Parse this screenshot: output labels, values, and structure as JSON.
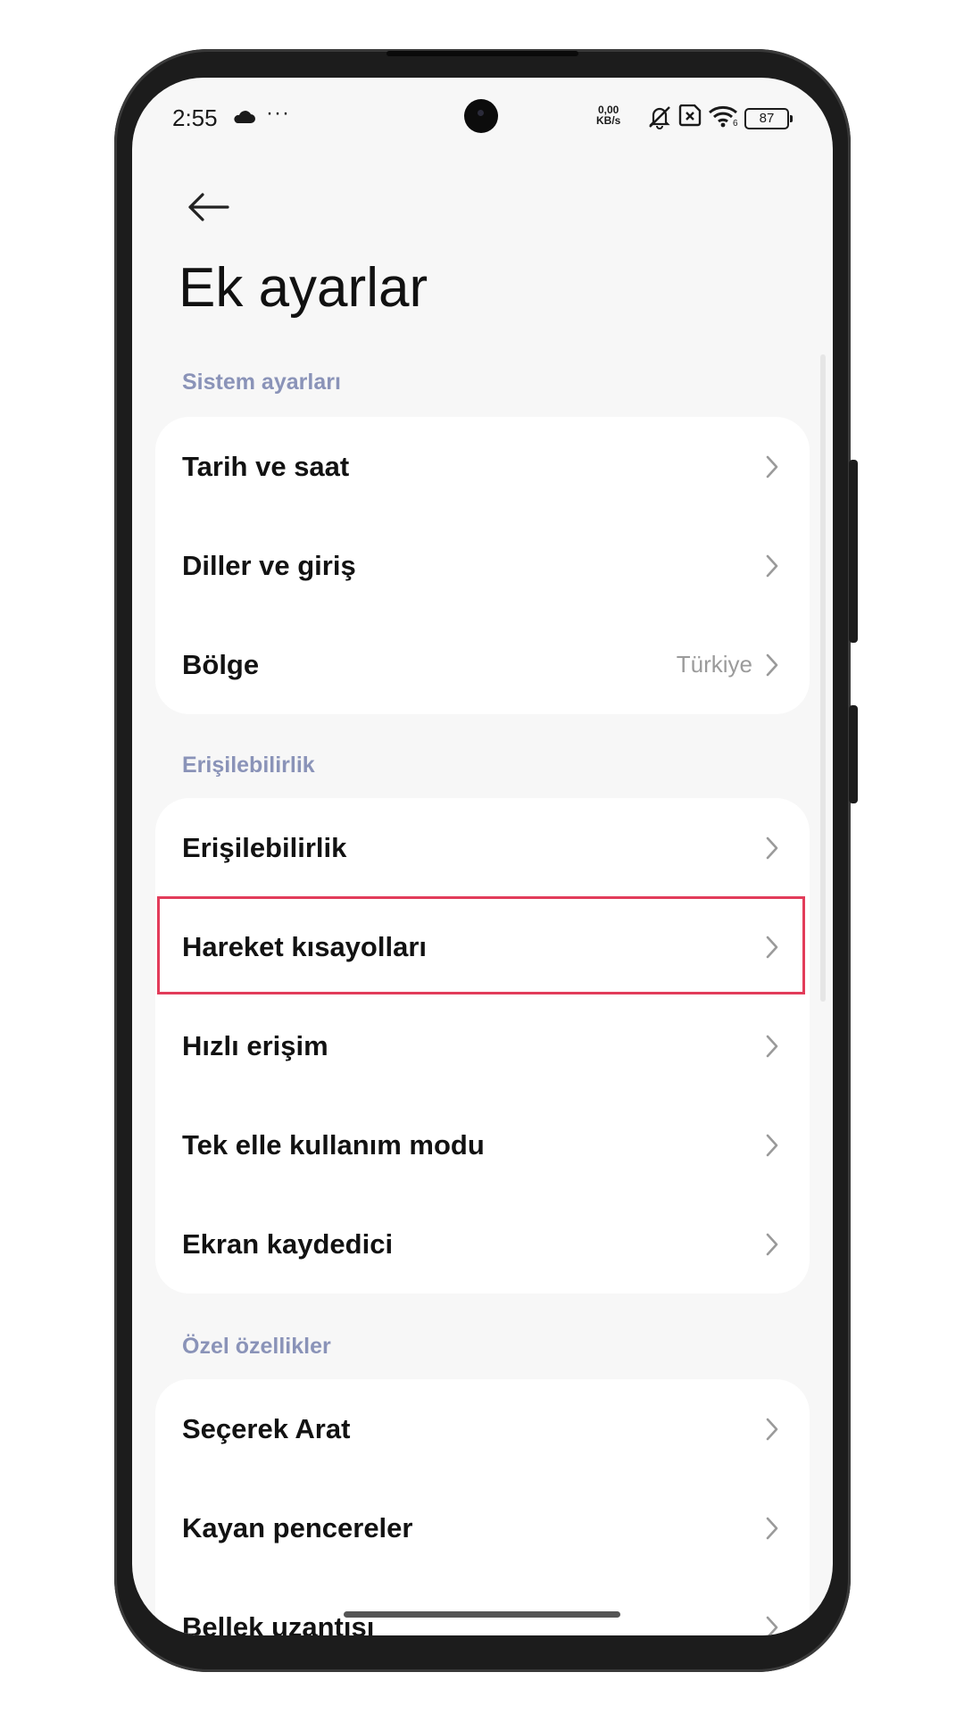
{
  "status_bar": {
    "time": "2:55",
    "more": "···",
    "net_speed_value": "0,00",
    "net_speed_unit": "KB/s",
    "wifi_sub": "6",
    "battery": "87"
  },
  "icons": {
    "back": "arrow-left-icon",
    "chevron": "chevron-right-icon",
    "cloud": "cloud-icon",
    "mute": "bell-off-icon",
    "sim": "sim-x-icon",
    "wifi": "wifi-icon"
  },
  "page": {
    "title": "Ek ayarlar"
  },
  "sections": [
    {
      "header": "Sistem ayarları",
      "items": [
        {
          "label": "Tarih ve saat",
          "value": ""
        },
        {
          "label": "Diller ve giriş",
          "value": ""
        },
        {
          "label": "Bölge",
          "value": "Türkiye"
        }
      ]
    },
    {
      "header": "Erişilebilirlik",
      "items": [
        {
          "label": "Erişilebilirlik",
          "value": ""
        },
        {
          "label": "Hareket kısayolları",
          "value": ""
        },
        {
          "label": "Hızlı erişim",
          "value": ""
        },
        {
          "label": "Tek elle kullanım modu",
          "value": ""
        },
        {
          "label": "Ekran kaydedici",
          "value": ""
        }
      ]
    },
    {
      "header": "Özel özellikler",
      "items": [
        {
          "label": "Seçerek Arat",
          "value": ""
        },
        {
          "label": "Kayan pencereler",
          "value": ""
        },
        {
          "label": "Bellek uzantısı",
          "value": ""
        }
      ]
    }
  ],
  "colors": {
    "section_header": "#8a93b8",
    "highlight": "#e23c5a",
    "screen_bg": "#f7f7f7",
    "card_bg": "#ffffff"
  }
}
